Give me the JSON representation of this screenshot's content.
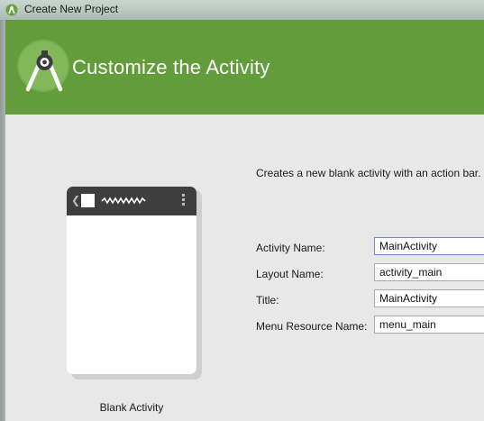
{
  "window": {
    "title": "Create New Project",
    "icon": "android-studio-icon"
  },
  "header": {
    "title": "Customize the Activity",
    "logo": "android-studio-logo",
    "color": "#629c3b"
  },
  "preview": {
    "label": "Blank Activity",
    "back_glyph": "❮"
  },
  "form": {
    "description": "Creates a new blank activity with an action bar.",
    "fields": [
      {
        "label": "Activity Name:",
        "value": "MainActivity"
      },
      {
        "label": "Layout Name:",
        "value": "activity_main"
      },
      {
        "label": "Title:",
        "value": "MainActivity"
      },
      {
        "label": "Menu Resource Name:",
        "value": "menu_main"
      }
    ]
  }
}
